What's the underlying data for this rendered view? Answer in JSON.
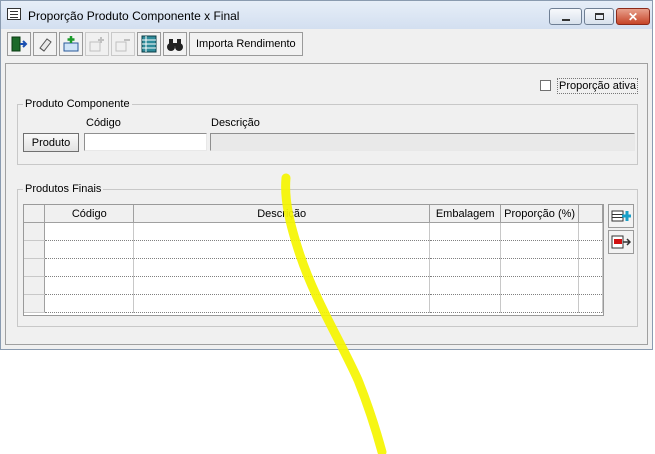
{
  "window": {
    "title": "Proporção Produto Componente x Final",
    "title_icon": "form-icon",
    "controls": {
      "minimize": "minimize-icon",
      "maximize": "maximize-icon",
      "close": "close-icon"
    }
  },
  "toolbar": {
    "buttons": [
      {
        "icon": "exit-door-icon",
        "enabled": true
      },
      {
        "icon": "eraser-icon",
        "enabled": true
      },
      {
        "icon": "add-record-icon",
        "enabled": true
      },
      {
        "icon": "insert-row-icon",
        "enabled": false
      },
      {
        "icon": "delete-row-icon",
        "enabled": false
      },
      {
        "icon": "spreadsheet-icon",
        "enabled": true
      },
      {
        "icon": "binoculars-icon",
        "enabled": true
      }
    ],
    "import_label": "Importa Rendimento"
  },
  "proporcao_ativa": {
    "label": "Proporção ativa",
    "checked": false
  },
  "componente": {
    "group_title": "Produto Componente",
    "codigo_label": "Código",
    "descricao_label": "Descrição",
    "produto_button": "Produto",
    "codigo_value": "",
    "descricao_value": ""
  },
  "finais": {
    "group_title": "Produtos Finais",
    "columns": [
      "Código",
      "Descrição",
      "Embalagem",
      "Proporção (%)"
    ],
    "rows": [
      [
        "",
        "",
        "",
        ""
      ],
      [
        "",
        "",
        "",
        ""
      ],
      [
        "",
        "",
        "",
        ""
      ],
      [
        "",
        "",
        "",
        ""
      ],
      [
        "",
        "",
        "",
        ""
      ]
    ],
    "side_buttons": [
      "add-row-icon",
      "remove-row-icon"
    ]
  },
  "colors": {
    "highlighter": "#f5f500",
    "title_bg": "#dde7f4",
    "close_red": "#c64528"
  }
}
